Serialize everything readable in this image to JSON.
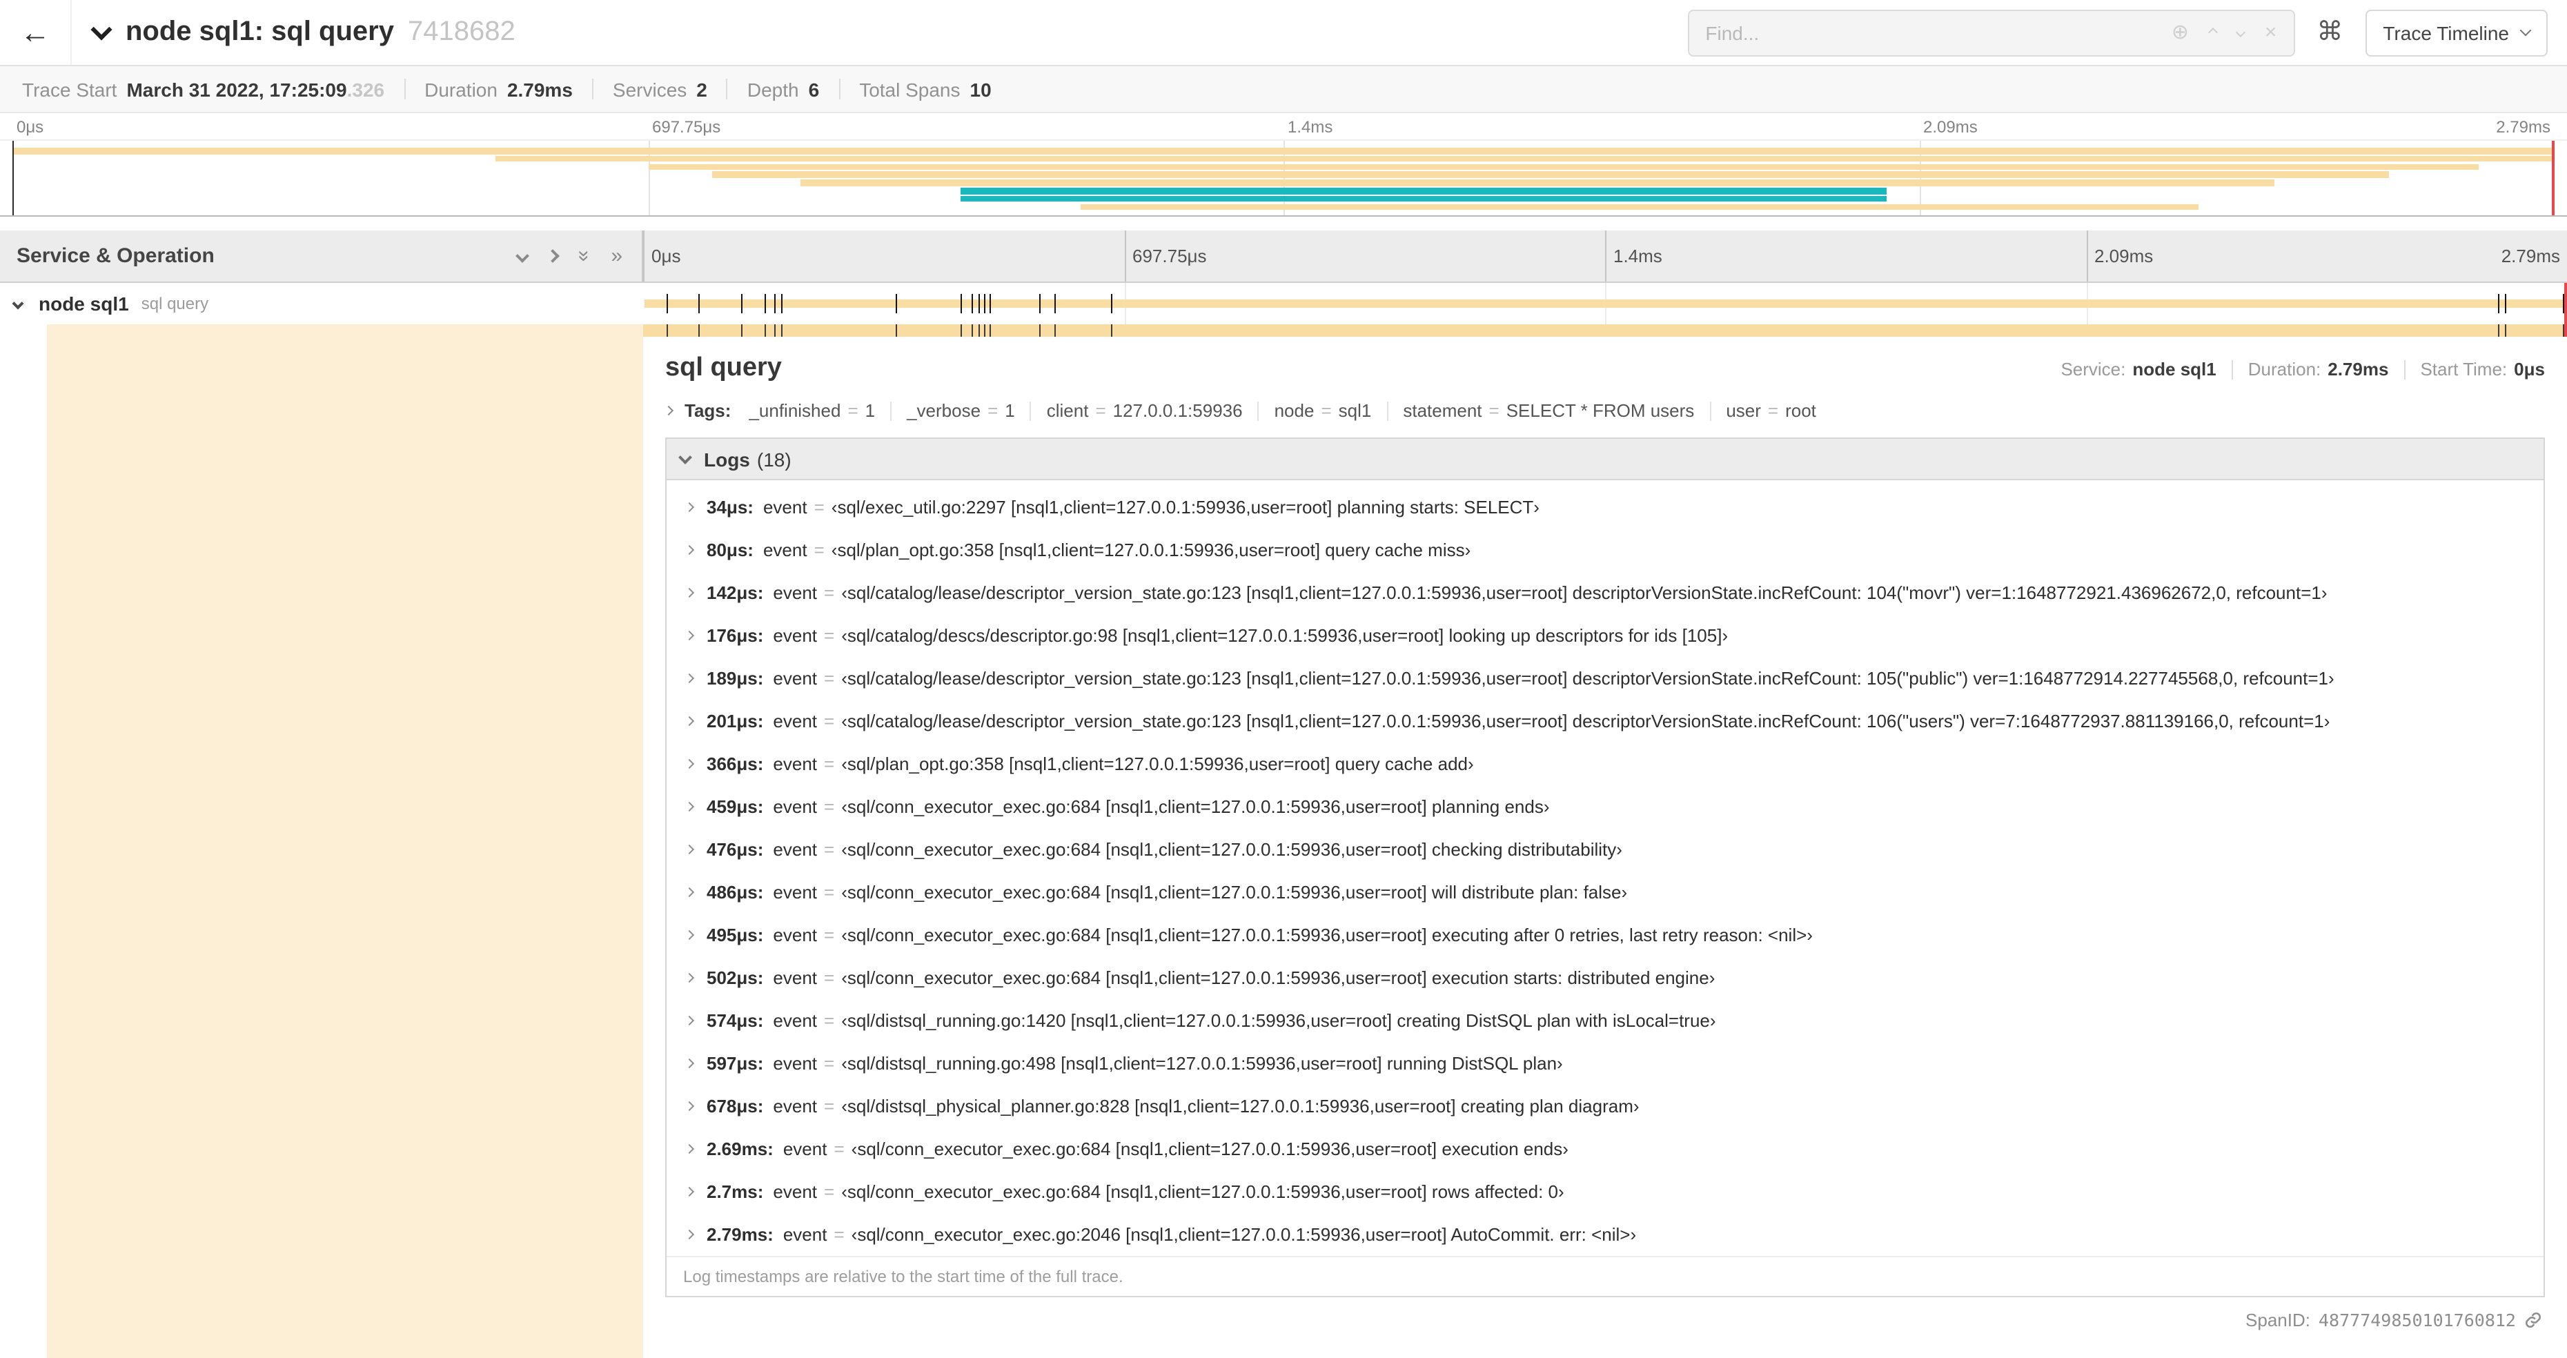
{
  "colors": {
    "span_tan": "#F8DCA1",
    "span_teal": "#17B8BE",
    "end_marker": "#e5484d"
  },
  "icons": {
    "back": "←",
    "zoom": "⊕",
    "clear": "×",
    "keyboard": "⌘",
    "double_chevron": "»"
  },
  "header": {
    "title": "node sql1: sql query",
    "trace_id_short": "7418682",
    "find_placeholder": "Find...",
    "view_dropdown_label": "Trace Timeline"
  },
  "trace_info": {
    "items": [
      {
        "label": "Trace Start",
        "value": "March 31 2022, 17:25:09",
        "suffix": ".326"
      },
      {
        "label": "Duration",
        "value": "2.79ms"
      },
      {
        "label": "Services",
        "value": "2"
      },
      {
        "label": "Depth",
        "value": "6"
      },
      {
        "label": "Total Spans",
        "value": "10"
      }
    ]
  },
  "time_ticks": [
    {
      "label": "0μs",
      "pct": 0
    },
    {
      "label": "697.75μs",
      "pct": 25
    },
    {
      "label": "1.4ms",
      "pct": 50
    },
    {
      "label": "2.09ms",
      "pct": 75
    },
    {
      "label": "2.79ms",
      "pct": 100,
      "align": "right"
    }
  ],
  "minimap": {
    "spans": [
      {
        "row": 0,
        "start": 0,
        "end": 100,
        "color": "#F8DCA1"
      },
      {
        "row": 1,
        "start": 19,
        "end": 100,
        "color": "#F8DCA1"
      },
      {
        "row": 2,
        "start": 25,
        "end": 97,
        "color": "#F8DCA1"
      },
      {
        "row": 3,
        "start": 27.5,
        "end": 93.5,
        "color": "#F8DCA1"
      },
      {
        "row": 4,
        "start": 31,
        "end": 89,
        "color": "#F8DCA1"
      },
      {
        "row": 5,
        "start": 37.3,
        "end": 73.7,
        "color": "#17B8BE"
      },
      {
        "row": 6,
        "start": 37.3,
        "end": 73.7,
        "color": "#17B8BE"
      },
      {
        "row": 7,
        "start": 42,
        "end": 86,
        "color": "#F8DCA1"
      }
    ]
  },
  "timeline": {
    "left_header": "Service & Operation",
    "row": {
      "service": "node sql1",
      "operation": "sql query"
    },
    "grid_pcts": [
      25,
      50,
      75
    ],
    "log_tick_pcts": [
      1.2,
      2.9,
      5.1,
      6.3,
      6.8,
      7.2,
      13.1,
      16.5,
      17.1,
      17.4,
      17.7,
      18,
      20.6,
      21.4,
      24.3,
      96.4,
      96.8,
      99.8
    ]
  },
  "detail": {
    "title": "sql query",
    "service_label": "Service:",
    "service_value": "node sql1",
    "duration_label": "Duration:",
    "duration_value": "2.79ms",
    "start_label": "Start Time:",
    "start_value": "0μs",
    "tags_label": "Tags:",
    "eq": "=",
    "tags": [
      {
        "key": "_unfinished",
        "value": "1"
      },
      {
        "key": "_verbose",
        "value": "1"
      },
      {
        "key": "client",
        "value": "127.0.0.1:59936"
      },
      {
        "key": "node",
        "value": "sql1"
      },
      {
        "key": "statement",
        "value": "SELECT * FROM users"
      },
      {
        "key": "user",
        "value": "root"
      }
    ],
    "logs_label": "Logs",
    "logs_count": "(18)",
    "log_field_key": "event",
    "logs": [
      {
        "time": "34μs:",
        "value": "‹sql/exec_util.go:2297 [nsql1,client=127.0.0.1:59936,user=root] planning starts: SELECT›"
      },
      {
        "time": "80μs:",
        "value": "‹sql/plan_opt.go:358 [nsql1,client=127.0.0.1:59936,user=root] query cache miss›"
      },
      {
        "time": "142μs:",
        "value": "‹sql/catalog/lease/descriptor_version_state.go:123 [nsql1,client=127.0.0.1:59936,user=root] descriptorVersionState.incRefCount: 104(\"movr\") ver=1:1648772921.436962672,0, refcount=1›"
      },
      {
        "time": "176μs:",
        "value": "‹sql/catalog/descs/descriptor.go:98 [nsql1,client=127.0.0.1:59936,user=root] looking up descriptors for ids [105]›"
      },
      {
        "time": "189μs:",
        "value": "‹sql/catalog/lease/descriptor_version_state.go:123 [nsql1,client=127.0.0.1:59936,user=root] descriptorVersionState.incRefCount: 105(\"public\") ver=1:1648772914.227745568,0, refcount=1›"
      },
      {
        "time": "201μs:",
        "value": "‹sql/catalog/lease/descriptor_version_state.go:123 [nsql1,client=127.0.0.1:59936,user=root] descriptorVersionState.incRefCount: 106(\"users\") ver=7:1648772937.881139166,0, refcount=1›"
      },
      {
        "time": "366μs:",
        "value": "‹sql/plan_opt.go:358 [nsql1,client=127.0.0.1:59936,user=root] query cache add›"
      },
      {
        "time": "459μs:",
        "value": "‹sql/conn_executor_exec.go:684 [nsql1,client=127.0.0.1:59936,user=root] planning ends›"
      },
      {
        "time": "476μs:",
        "value": "‹sql/conn_executor_exec.go:684 [nsql1,client=127.0.0.1:59936,user=root] checking distributability›"
      },
      {
        "time": "486μs:",
        "value": "‹sql/conn_executor_exec.go:684 [nsql1,client=127.0.0.1:59936,user=root] will distribute plan: false›"
      },
      {
        "time": "495μs:",
        "value": "‹sql/conn_executor_exec.go:684 [nsql1,client=127.0.0.1:59936,user=root] executing after 0 retries, last retry reason: <nil>›"
      },
      {
        "time": "502μs:",
        "value": "‹sql/conn_executor_exec.go:684 [nsql1,client=127.0.0.1:59936,user=root] execution starts: distributed engine›"
      },
      {
        "time": "574μs:",
        "value": "‹sql/distsql_running.go:1420 [nsql1,client=127.0.0.1:59936,user=root] creating DistSQL plan with isLocal=true›"
      },
      {
        "time": "597μs:",
        "value": "‹sql/distsql_running.go:498 [nsql1,client=127.0.0.1:59936,user=root] running DistSQL plan›"
      },
      {
        "time": "678μs:",
        "value": "‹sql/distsql_physical_planner.go:828 [nsql1,client=127.0.0.1:59936,user=root] creating plan diagram›"
      },
      {
        "time": "2.69ms:",
        "value": "‹sql/conn_executor_exec.go:684 [nsql1,client=127.0.0.1:59936,user=root] execution ends›"
      },
      {
        "time": "2.7ms:",
        "value": "‹sql/conn_executor_exec.go:684 [nsql1,client=127.0.0.1:59936,user=root] rows affected: 0›"
      },
      {
        "time": "2.79ms:",
        "value": "‹sql/conn_executor_exec.go:2046 [nsql1,client=127.0.0.1:59936,user=root] AutoCommit. err: <nil>›"
      }
    ],
    "footer_note": "Log timestamps are relative to the start time of the full trace.",
    "span_id_label": "SpanID:",
    "span_id_value": "4877749850101760812"
  }
}
